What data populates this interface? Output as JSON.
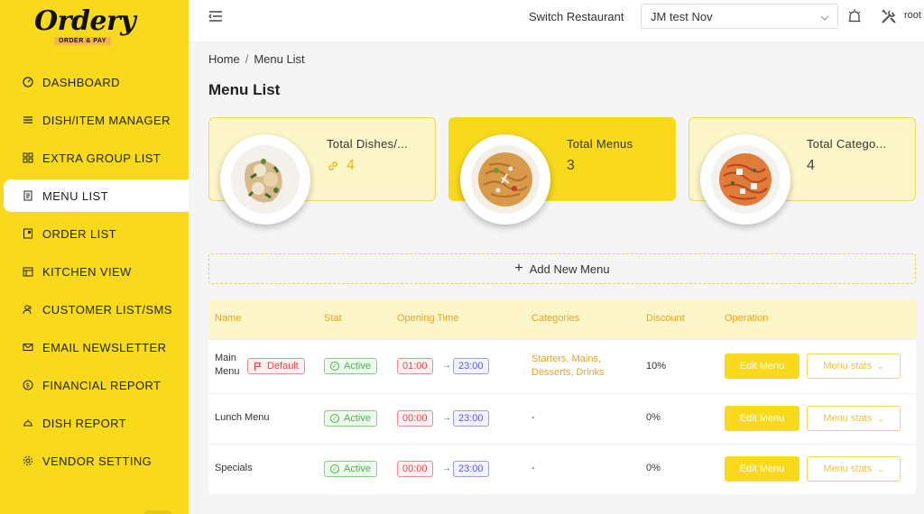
{
  "brand": {
    "name": "Ordery",
    "tagline": "ORDER & PAY"
  },
  "sidebar": {
    "items": [
      {
        "label": "DASHBOARD",
        "icon": "dashboard-icon"
      },
      {
        "label": "DISH/ITEM MANAGER",
        "icon": "list-icon"
      },
      {
        "label": "EXTRA GROUP LIST",
        "icon": "grid-icon"
      },
      {
        "label": "MENU LIST",
        "icon": "menu-book-icon",
        "active": true
      },
      {
        "label": "ORDER LIST",
        "icon": "order-icon"
      },
      {
        "label": "KITCHEN VIEW",
        "icon": "kitchen-icon"
      },
      {
        "label": "CUSTOMER LIST/SMS",
        "icon": "users-icon"
      },
      {
        "label": "EMAIL NEWSLETTER",
        "icon": "mail-icon"
      },
      {
        "label": "FINANCIAL REPORT",
        "icon": "dollar-icon"
      },
      {
        "label": "DISH REPORT",
        "icon": "dish-icon"
      },
      {
        "label": "VENDOR SETTING",
        "icon": "gear-icon"
      }
    ]
  },
  "topbar": {
    "switch_label": "Switch Restaurant",
    "restaurant": "JM test Nov",
    "user": "root"
  },
  "breadcrumb": {
    "home": "Home",
    "current": "Menu List"
  },
  "page_title": "Menu List",
  "cards": [
    {
      "label": "Total Dishes/...",
      "value": "4"
    },
    {
      "label": "Total Menus",
      "value": "3"
    },
    {
      "label": "Total Catego...",
      "value": "4"
    }
  ],
  "add_menu_label": "Add New Menu",
  "table": {
    "headers": [
      "Name",
      "Stat",
      "Opening Time",
      "Categories",
      "Discount",
      "Operation"
    ],
    "rows": [
      {
        "name_line1": "Main",
        "name_line2": "Menu",
        "default_badge": "Default",
        "status": "Active",
        "open": "01:00",
        "close": "23:00",
        "cat_line1": "Starters, Mains,",
        "cat_line2": "Desserts, Drinks",
        "discount": "10%",
        "edit": "Edit Menu",
        "stats": "Menu stats"
      },
      {
        "name_line1": "Lunch Menu",
        "status": "Active",
        "open": "00:00",
        "close": "23:00",
        "categories": "-",
        "discount": "0%",
        "edit": "Edit Menu",
        "stats": "Menu stats"
      },
      {
        "name_line1": "Specials",
        "status": "Active",
        "open": "00:00",
        "close": "23:00",
        "categories": "-",
        "discount": "0%",
        "edit": "Edit Menu",
        "stats": "Menu stats"
      }
    ]
  },
  "colors": {
    "brand_yellow": "#f8d91c",
    "header_tint": "#fdf6c8",
    "accent_orange": "#e8a321"
  }
}
